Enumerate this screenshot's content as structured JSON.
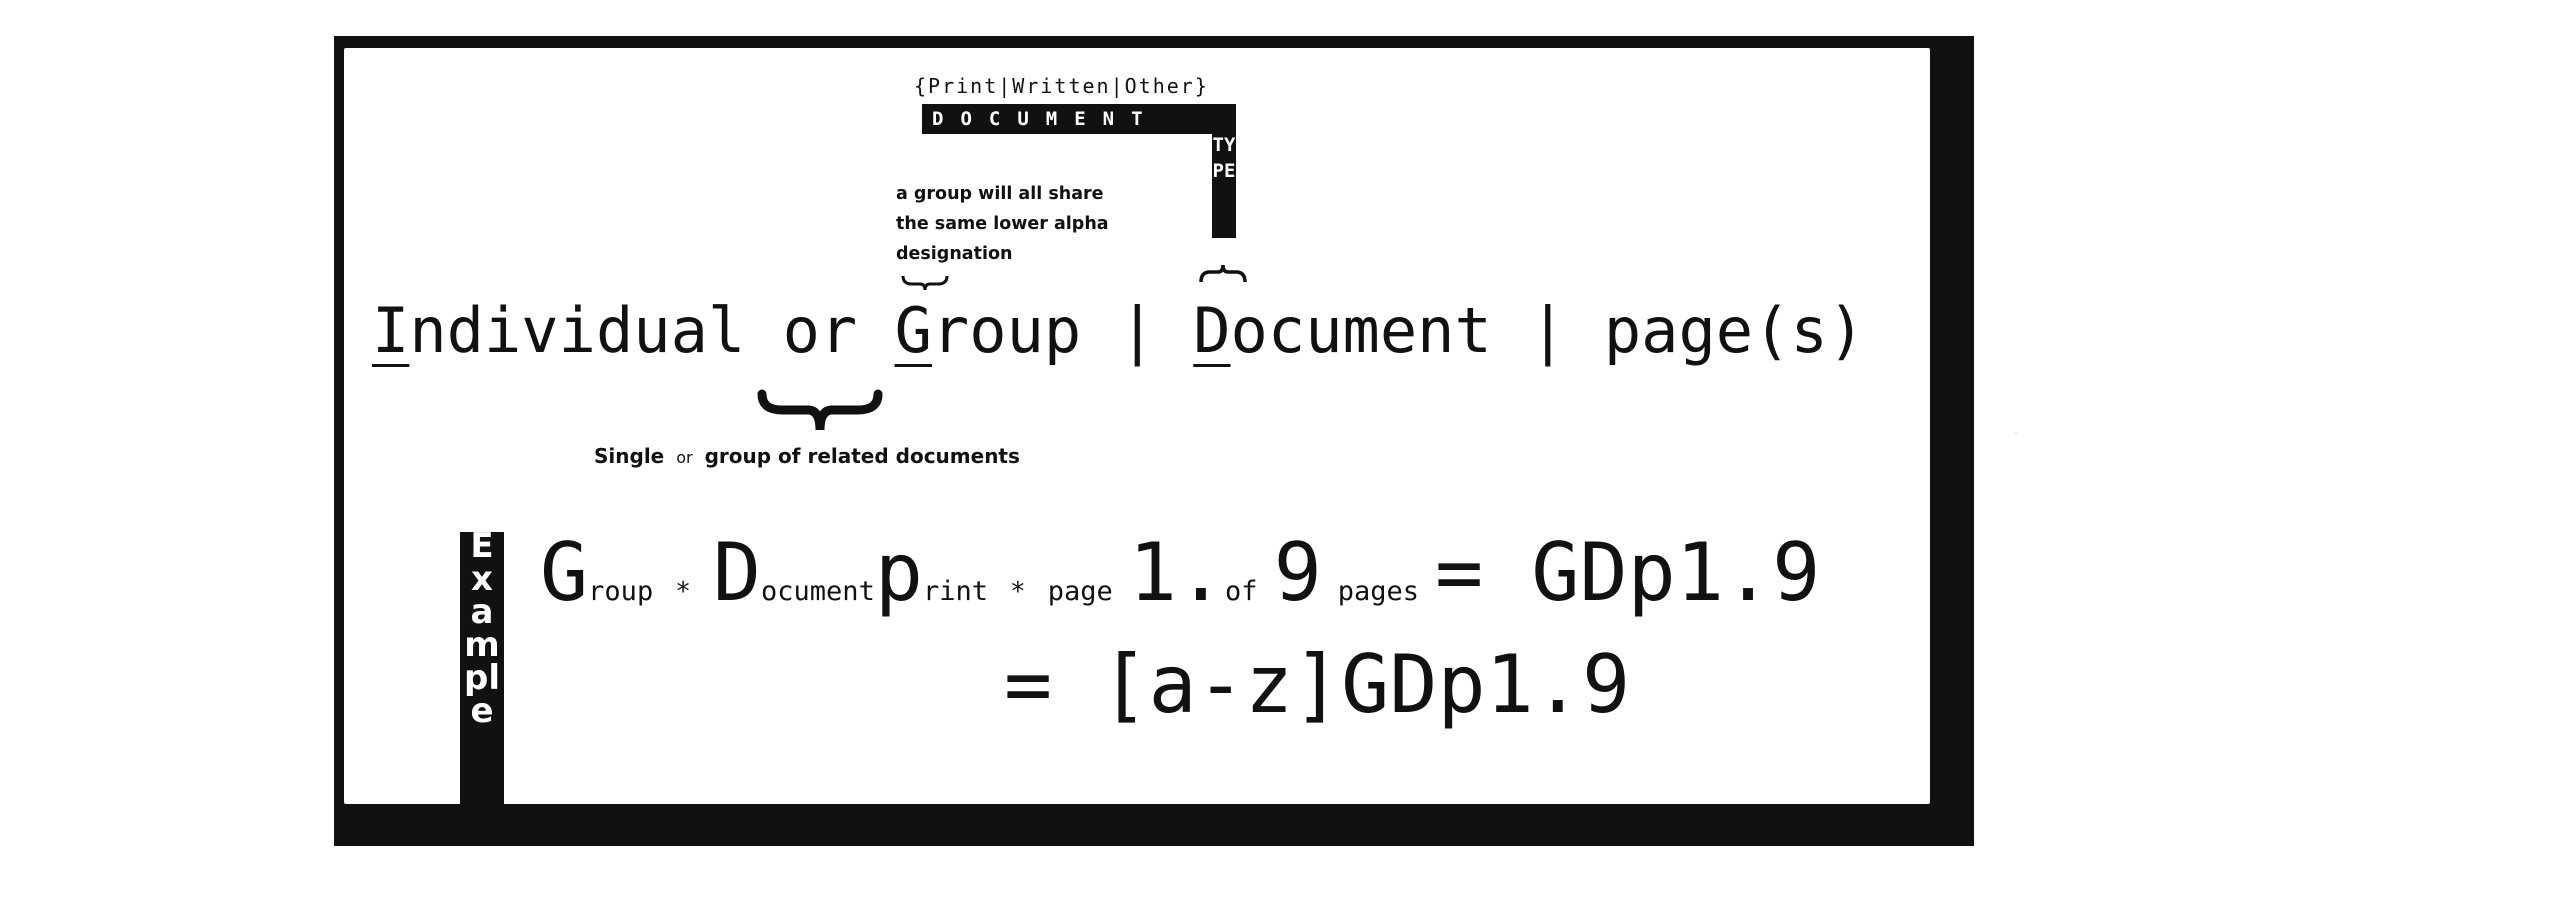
{
  "document_type": {
    "options": "{Print|Written|Other}",
    "label": "DOCUMENT",
    "vertical_label": "TYPE"
  },
  "group_note": "a group will all share the same lower alpha designation",
  "main_line": {
    "individual_initial": "I",
    "individual_rest": "ndividual",
    "or": "or",
    "group_initial": "G",
    "group_rest": "roup",
    "sep1": "|",
    "document_initial": "D",
    "document_rest": "ocument",
    "sep2": "|",
    "pages": "page(s)"
  },
  "single_note": {
    "single": "Single",
    "or": "or",
    "rest": "group of related documents"
  },
  "example": {
    "label": "Example",
    "g": "G",
    "group_sub": "roup",
    "star1": "*",
    "d": "D",
    "document_sub": "ocument",
    "p": "p",
    "print_sub": "rint",
    "star2": "*",
    "page_sub": "page",
    "one": "1.",
    "of_sub": "of",
    "nine": "9",
    "pages_sub": "pages",
    "equals_result": "= GDp1.9",
    "line2": "= [a-z]GDp1.9"
  }
}
